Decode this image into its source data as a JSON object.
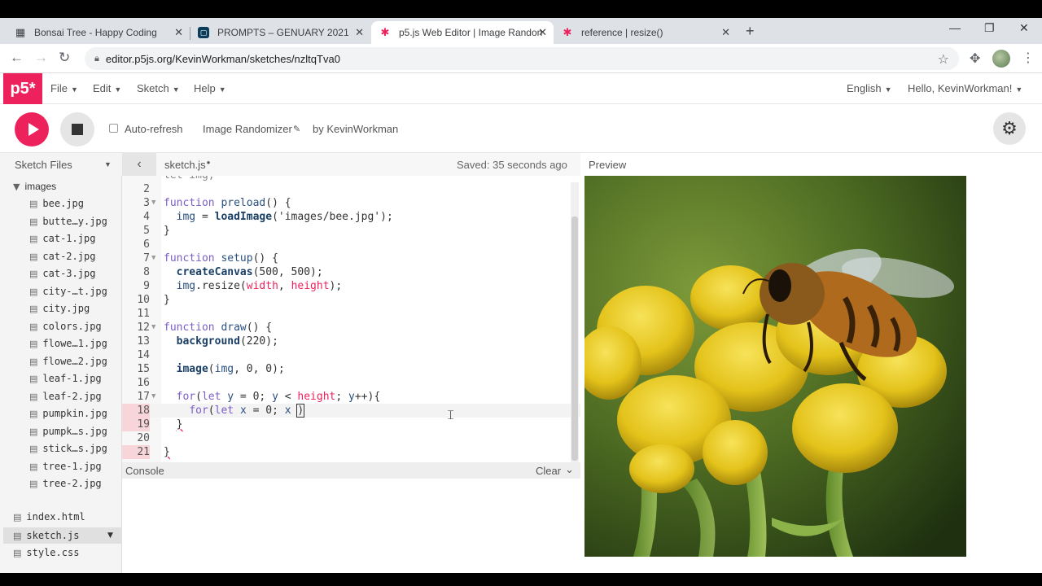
{
  "browser": {
    "tabs": [
      {
        "title": "Bonsai Tree - Happy Coding",
        "favicon": "window-icon"
      },
      {
        "title": "PROMPTS – GENUARY 2021",
        "favicon": "genuary-icon"
      },
      {
        "title": "p5.js Web Editor | Image Randon",
        "favicon": "p5-asterisk-icon"
      },
      {
        "title": "reference | resize()",
        "favicon": "p5-asterisk-icon"
      }
    ],
    "url": "editor.p5js.org/KevinWorkman/sketches/nzltqTva0"
  },
  "nav": {
    "logo": "p5*",
    "menus": [
      "File",
      "Edit",
      "Sketch",
      "Help"
    ],
    "language": "English",
    "user": "Hello, KevinWorkman!"
  },
  "toolbar": {
    "auto_refresh": "Auto-refresh",
    "sketch_name": "Image Randomizer",
    "author": "by KevinWorkman"
  },
  "sidebar": {
    "title": "Sketch Files",
    "folder": "images",
    "images": [
      "bee.jpg",
      "butte…y.jpg",
      "cat-1.jpg",
      "cat-2.jpg",
      "cat-3.jpg",
      "city-…t.jpg",
      "city.jpg",
      "colors.jpg",
      "flowe…1.jpg",
      "flowe…2.jpg",
      "leaf-1.jpg",
      "leaf-2.jpg",
      "pumpkin.jpg",
      "pumpk…s.jpg",
      "stick…s.jpg",
      "tree-1.jpg",
      "tree-2.jpg"
    ],
    "root_files": [
      "index.html",
      "sketch.js",
      "style.css"
    ]
  },
  "editor": {
    "filename": "sketch.js",
    "saved": "Saved: 35 seconds ago",
    "partial_line": "let img;",
    "line_numbers": [
      "2",
      "3",
      "4",
      "5",
      "6",
      "7",
      "8",
      "9",
      "10",
      "11",
      "12",
      "13",
      "14",
      "15",
      "16",
      "17",
      "18",
      "19",
      "20",
      "21"
    ]
  },
  "preview": {
    "label": "Preview"
  },
  "console": {
    "label": "Console",
    "clear": "Clear"
  },
  "colors": {
    "accent": "#ed225d"
  }
}
